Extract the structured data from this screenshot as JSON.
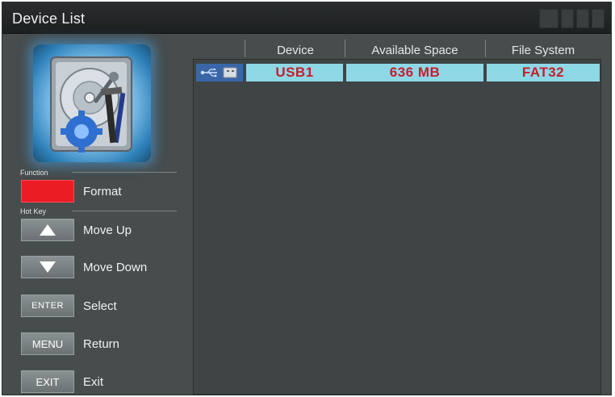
{
  "window": {
    "title": "Device List"
  },
  "function_section": {
    "label": "Function",
    "items": [
      {
        "key_label": "",
        "key_color": "#ec1c24",
        "action": "Format"
      }
    ]
  },
  "hotkey_section": {
    "label": "Hot Key",
    "items": [
      {
        "key_icon": "arrow-up-icon",
        "key_label": "",
        "action": "Move Up"
      },
      {
        "key_icon": "arrow-down-icon",
        "key_label": "",
        "action": "Move Down"
      },
      {
        "key_label": "ENTER",
        "action": "Select"
      },
      {
        "key_label": "MENU",
        "action": "Return"
      },
      {
        "key_label": "EXIT",
        "action": "Exit"
      }
    ]
  },
  "device_table": {
    "columns": [
      "Device",
      "Available Space",
      "File System"
    ],
    "rows": [
      {
        "icon": "usb-icon",
        "device": "USB1",
        "available_space": "636 MB",
        "file_system": "FAT32"
      }
    ],
    "selected_row_color": "#8ed8e6",
    "selected_text_color": "#c41f2e"
  },
  "illustration": {
    "icon": "hard-disk-tools-icon"
  }
}
